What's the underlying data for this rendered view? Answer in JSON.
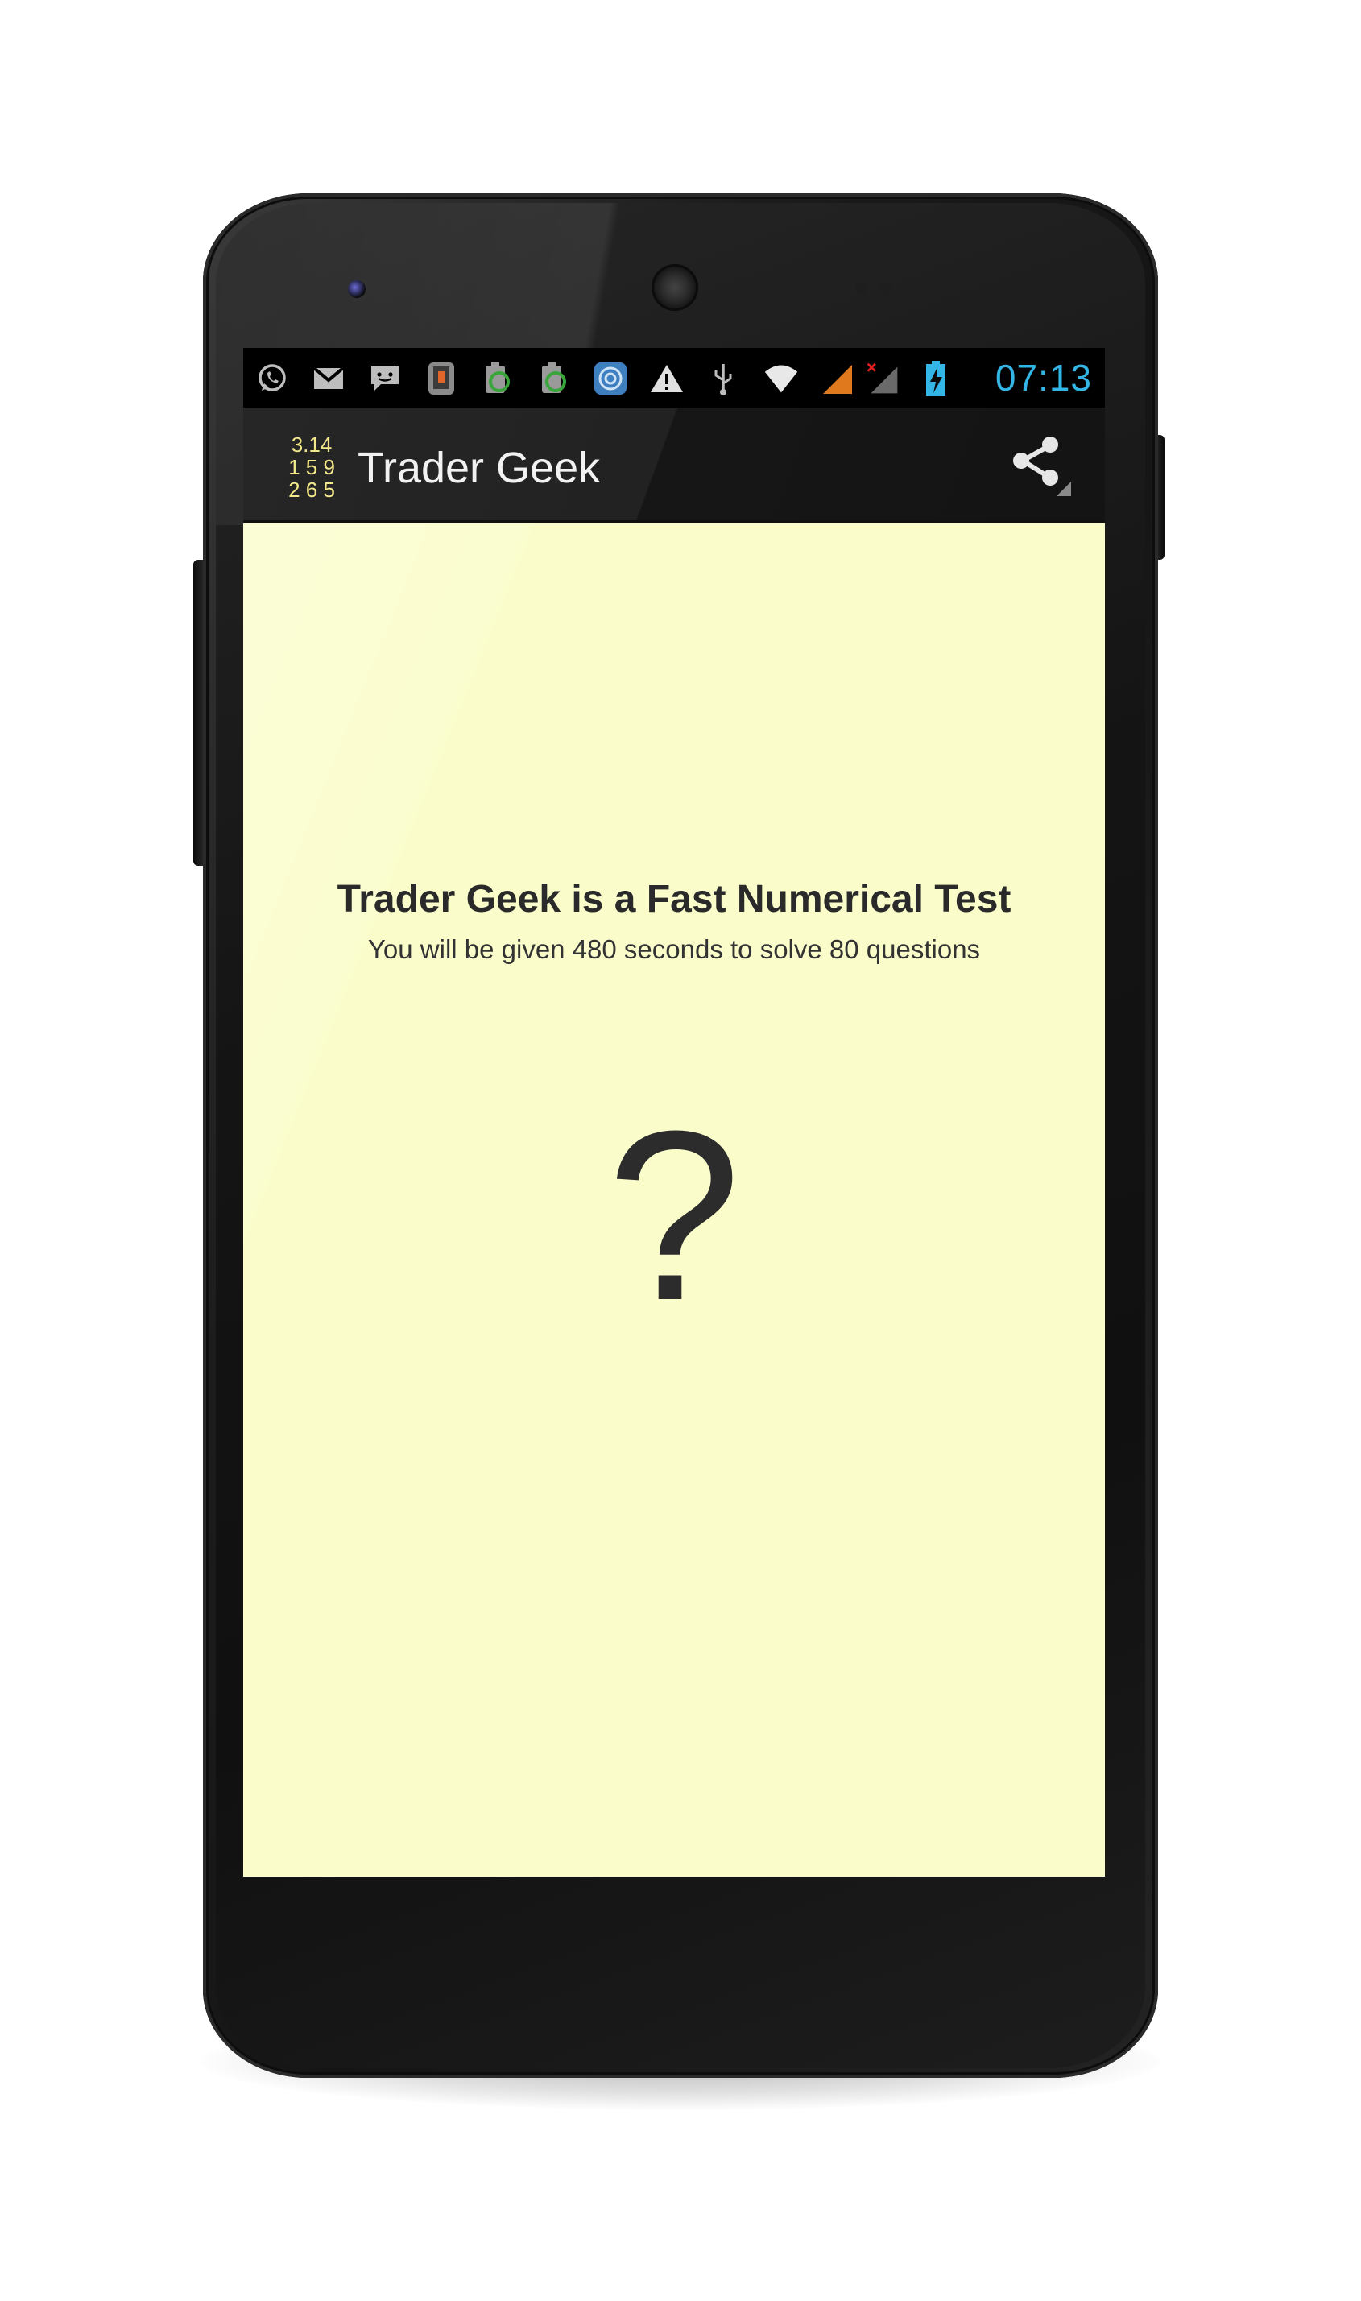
{
  "status_bar": {
    "time": "07:13",
    "time_color": "#33b5e5",
    "icons": [
      "whatsapp-icon",
      "gmail-icon",
      "chat-icon",
      "phone-app-icon",
      "battery-saver-icon",
      "battery-saver-icon",
      "target-app-icon",
      "warning-icon",
      "usb-icon",
      "wifi-icon",
      "signal-icon",
      "no-signal-icon",
      "battery-charging-icon"
    ]
  },
  "action_bar": {
    "logo_text": "3.14\n1 5 9\n2 6 5",
    "title": "Trader Geek",
    "share_icon": "share-icon"
  },
  "main": {
    "headline": "Trader Geek is a Fast Numerical Test",
    "subline": "You will be given 480 seconds to solve 80 questions",
    "symbol": "?"
  },
  "colors": {
    "content_background": "#fafdca",
    "action_bar": "#1f1f1f",
    "logo": "#f4e98a"
  }
}
